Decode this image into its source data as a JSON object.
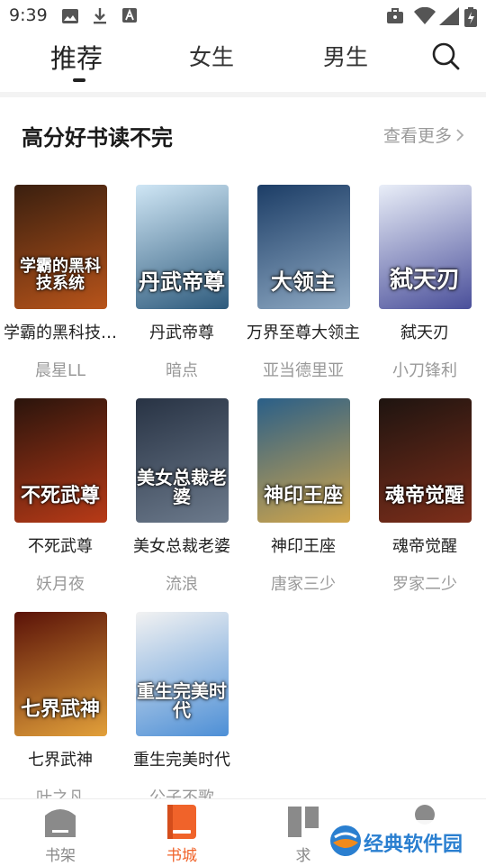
{
  "status_bar": {
    "time": "9:39"
  },
  "tabs": [
    {
      "label": "推荐",
      "active": true
    },
    {
      "label": "女生",
      "active": false
    },
    {
      "label": "男生",
      "active": false
    }
  ],
  "section": {
    "title": "高分好书读不完",
    "more": "查看更多"
  },
  "books": [
    {
      "title": "学霸的黑科技系统",
      "author": "晨星LL",
      "cover_text": "学霸的黑科技系统",
      "cover_colors": [
        "#3a1f0f",
        "#b8541a"
      ]
    },
    {
      "title": "丹武帝尊",
      "author": "暗点",
      "cover_text": "丹武帝尊",
      "cover_colors": [
        "#cfe6f5",
        "#2d5a7c"
      ]
    },
    {
      "title": "万界至尊大领主",
      "author": "亚当德里亚",
      "cover_text": "大领主",
      "cover_colors": [
        "#1c3d66",
        "#8ea9c3"
      ]
    },
    {
      "title": "弑天刃",
      "author": "小刀锋利",
      "cover_text": "弑天刃",
      "cover_colors": [
        "#e9eef8",
        "#4a4f9a"
      ]
    },
    {
      "title": "不死武尊",
      "author": "妖月夜",
      "cover_text": "不死武尊",
      "cover_colors": [
        "#2a140c",
        "#b83a17"
      ]
    },
    {
      "title": "美女总裁老婆",
      "author": "流浪",
      "cover_text": "美女总裁老婆",
      "cover_colors": [
        "#283344",
        "#6c7a8c"
      ]
    },
    {
      "title": "神印王座",
      "author": "唐家三少",
      "cover_text": "神印王座",
      "cover_colors": [
        "#2a5f88",
        "#d2a64a"
      ]
    },
    {
      "title": "魂帝觉醒",
      "author": "罗家二少",
      "cover_text": "魂帝觉醒",
      "cover_colors": [
        "#1e1410",
        "#7d2e1a"
      ]
    },
    {
      "title": "七界武神",
      "author": "叶之凡",
      "cover_text": "七界武神",
      "cover_colors": [
        "#5a1208",
        "#e2a03a"
      ]
    },
    {
      "title": "重生完美时代",
      "author": "公子不歌",
      "cover_text": "重生完美时代",
      "cover_colors": [
        "#f2f2f2",
        "#4d8fd6"
      ]
    }
  ],
  "bottom_nav": [
    {
      "label": "书架",
      "icon": "bookshelf-icon",
      "active": false
    },
    {
      "label": "书城",
      "icon": "bookstore-icon",
      "active": true
    },
    {
      "label": "求",
      "icon": "request-icon",
      "active": false
    },
    {
      "label": "",
      "icon": "profile-icon",
      "active": false
    }
  ],
  "watermark": {
    "text": "经典软件园"
  },
  "colors": {
    "accent": "#f0632a",
    "muted": "#999999",
    "title": "#222222"
  }
}
